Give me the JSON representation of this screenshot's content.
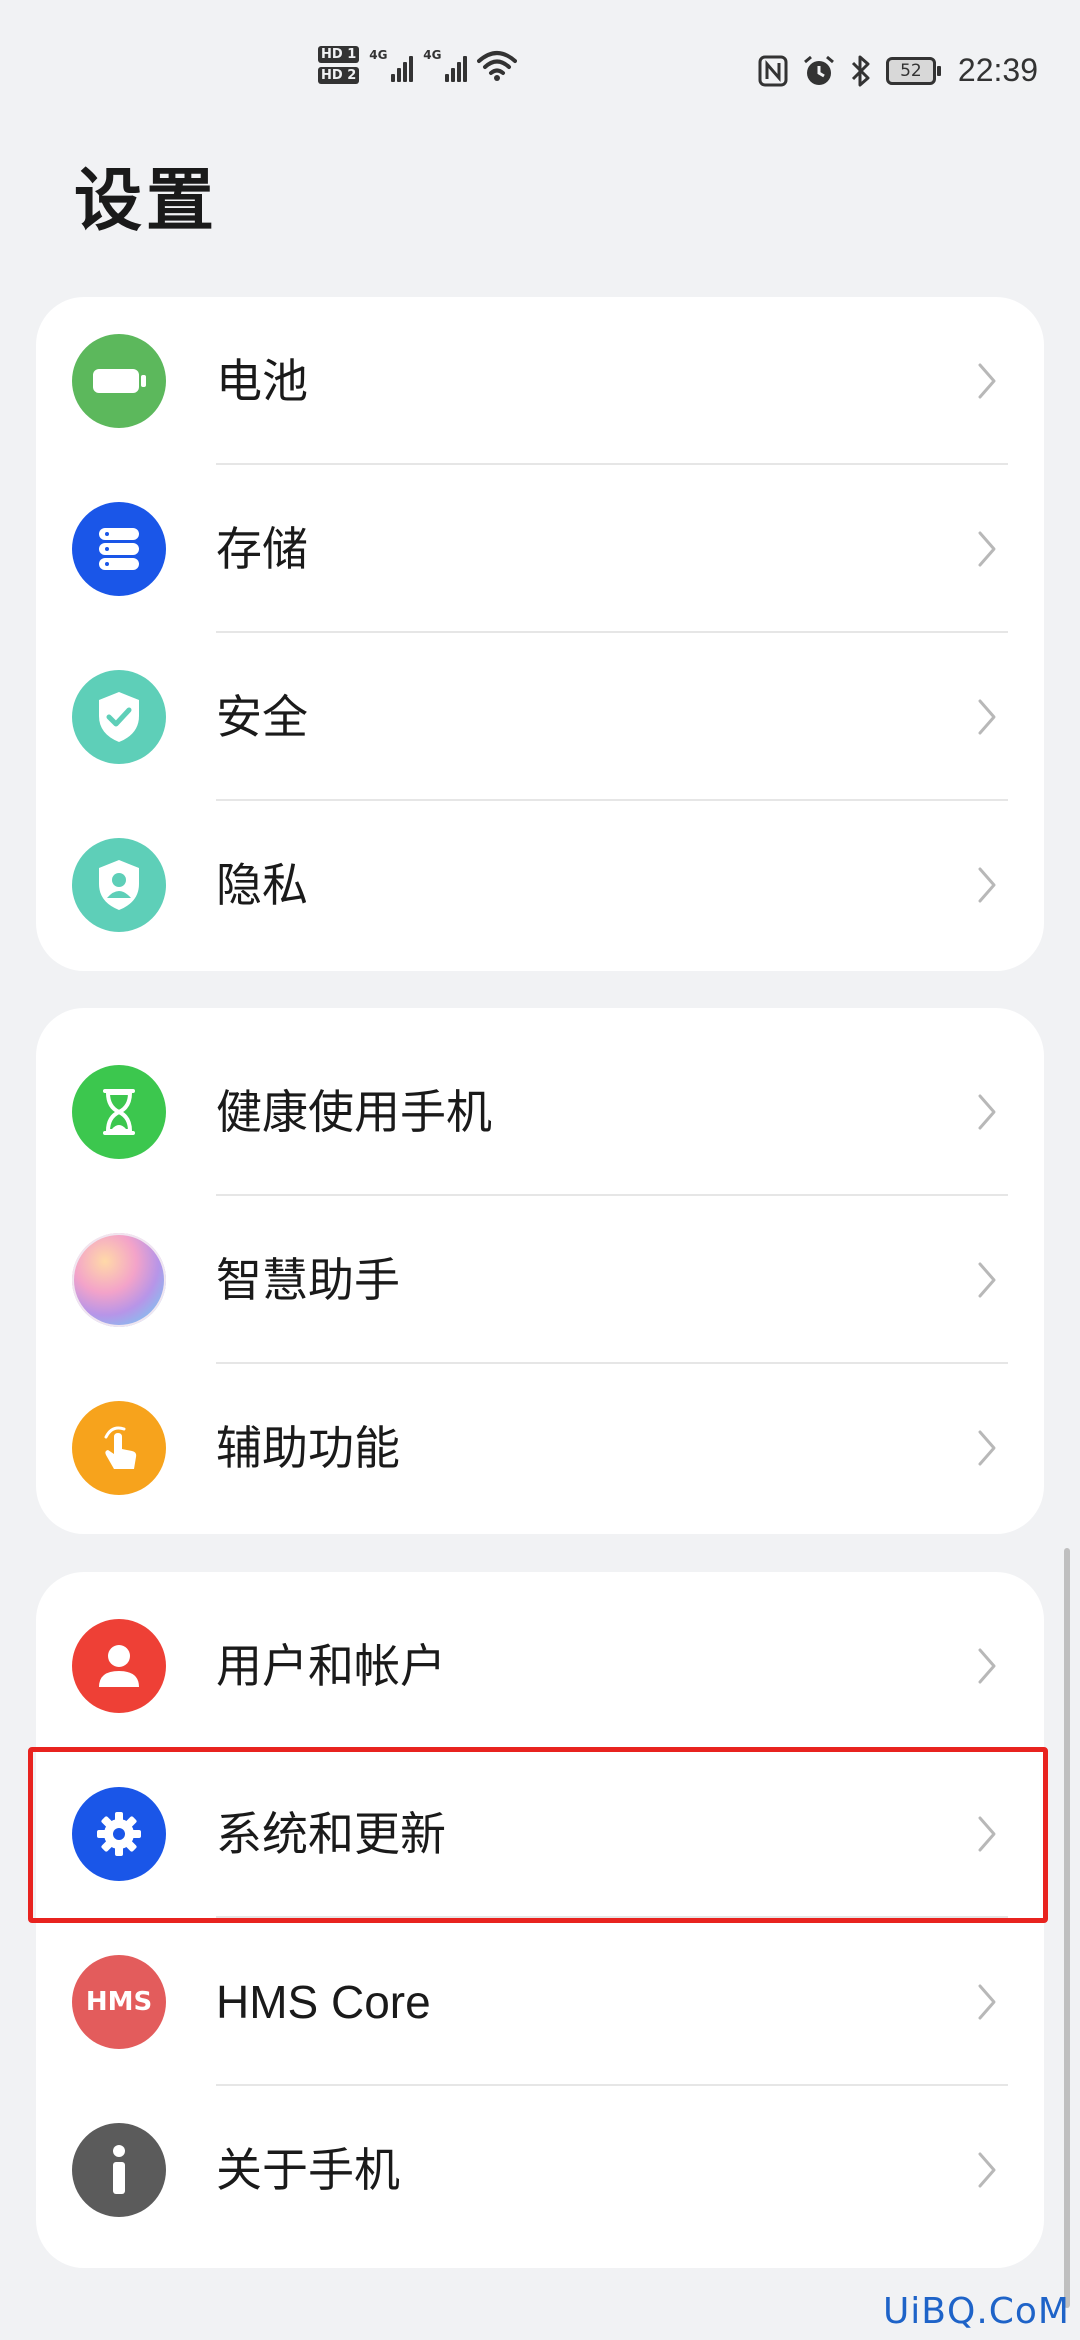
{
  "status_bar": {
    "sim1": "HD 1",
    "sim2": "HD 2",
    "network1": "4G",
    "network2": "4G",
    "battery_level": "52",
    "time": "22:39"
  },
  "page_title": "设置",
  "groups": [
    {
      "items": [
        {
          "label": "电池",
          "icon": "battery-icon",
          "color": "#5cb85c"
        },
        {
          "label": "存储",
          "icon": "storage-icon",
          "color": "#1a56e8"
        },
        {
          "label": "安全",
          "icon": "shield-check-icon",
          "color": "#5ecfb8"
        },
        {
          "label": "隐私",
          "icon": "privacy-shield-icon",
          "color": "#5ecfb8"
        }
      ]
    },
    {
      "items": [
        {
          "label": "健康使用手机",
          "icon": "hourglass-icon",
          "color": "#3cc74e"
        },
        {
          "label": "智慧助手",
          "icon": "smart-assistant-icon",
          "color": "#e9a3d3"
        },
        {
          "label": "辅助功能",
          "icon": "hand-tap-icon",
          "color": "#f7a31c"
        }
      ]
    },
    {
      "items": [
        {
          "label": "用户和帐户",
          "icon": "user-icon",
          "color": "#ee4036"
        },
        {
          "label": "系统和更新",
          "icon": "gear-icon",
          "color": "#1a56e8"
        },
        {
          "label": "HMS Core",
          "icon": "hms-icon",
          "icon_text": "HMS",
          "color": "#e35c5c"
        },
        {
          "label": "关于手机",
          "icon": "info-icon",
          "color": "#5b5b5b"
        }
      ]
    }
  ],
  "watermark": "UiBQ.CoM",
  "highlight_color": "#e8231f"
}
